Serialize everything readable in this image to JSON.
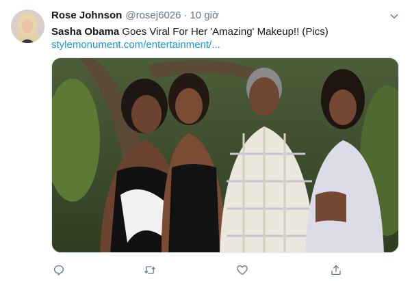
{
  "tweet": {
    "author_name": "Rose Johnson",
    "author_handle": "@rosej6026",
    "separator": "·",
    "timestamp": "10 giờ",
    "text_bold": "Sasha Obama",
    "text_rest": " Goes Viral For Her 'Amazing' Makeup!! (Pics)",
    "link_text": "stylemonument.com/entertainment/..."
  },
  "icons": {
    "more": "chevron-down-icon",
    "reply": "reply-icon",
    "retweet": "retweet-icon",
    "like": "heart-icon",
    "share": "share-icon"
  },
  "colors": {
    "name": "#14171a",
    "secondary": "#657786",
    "link": "#1b95e0",
    "icon": "#657786"
  }
}
